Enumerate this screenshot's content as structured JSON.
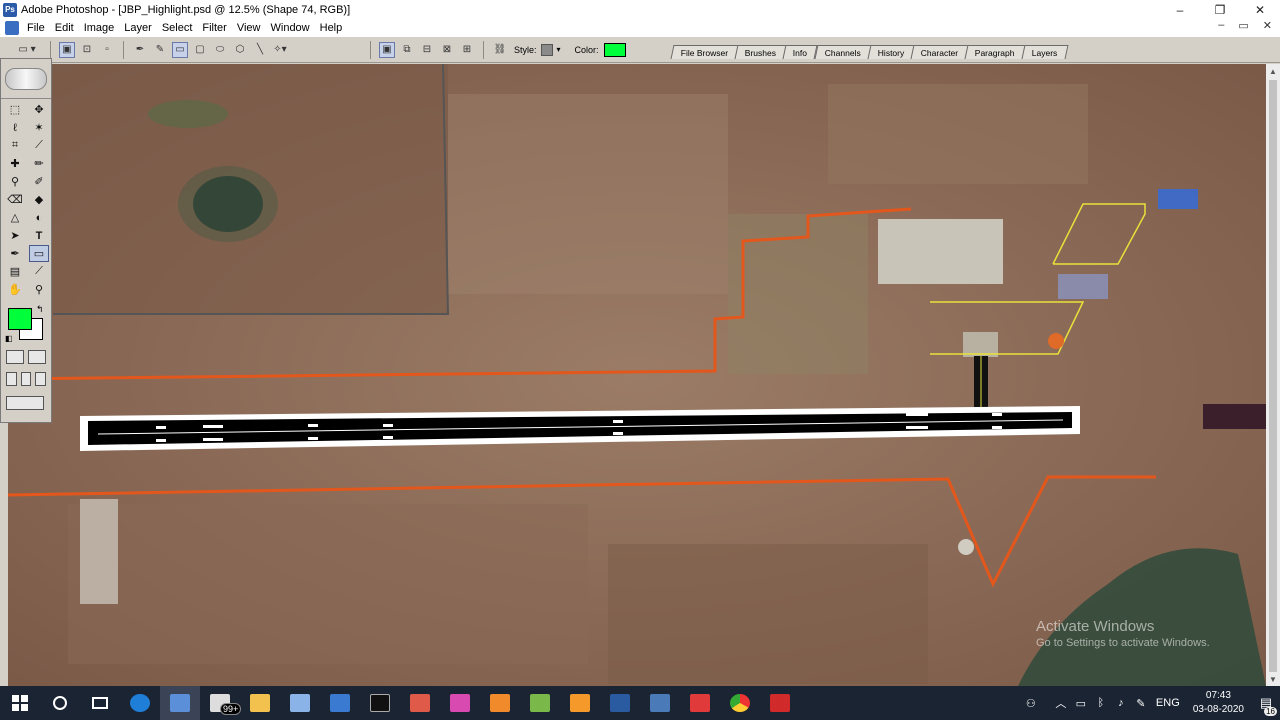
{
  "window": {
    "title": "Adobe Photoshop - [JBP_Highlight.psd @ 12.5% (Shape 74, RGB)]",
    "app_icon": "photoshop-icon",
    "minimize": "–",
    "maximize": "❐",
    "close": "✕"
  },
  "menubar": {
    "items": [
      "File",
      "Edit",
      "Image",
      "Layer",
      "Select",
      "Filter",
      "View",
      "Window",
      "Help"
    ],
    "doc_minimize": "–",
    "doc_restore": "▭",
    "doc_close": "✕"
  },
  "options": {
    "style_label": "Style:",
    "color_label": "Color:",
    "color": "#00ff3a"
  },
  "palette_tabs": [
    "File Browser",
    "Brushes",
    "Info",
    "Channels",
    "History",
    "Character",
    "Paragraph",
    "Layers"
  ],
  "toolbox": {
    "foreground_color": "#00ff3a",
    "background_color": "#ffffff"
  },
  "canvas": {
    "watermark_title": "Activate Windows",
    "watermark_sub": "Go to Settings to activate Windows."
  },
  "taskbar": {
    "mail_badge": "99+",
    "language": "ENG",
    "time": "07:43",
    "date": "03-08-2020",
    "notifications": "16"
  }
}
